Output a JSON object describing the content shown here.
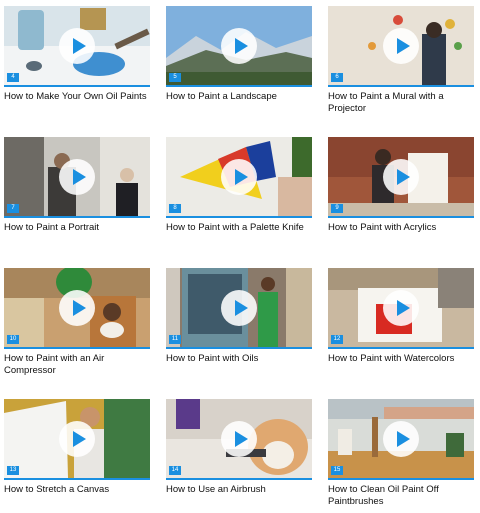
{
  "accent_color": "#1a8fe0",
  "videos": [
    {
      "number": "4",
      "title": "How to Make Your Own Oil Paints",
      "play_icon": "play-icon"
    },
    {
      "number": "5",
      "title": "How to Paint a Landscape",
      "play_icon": "play-icon"
    },
    {
      "number": "6",
      "title": "How to Paint a Mural with a Projector",
      "play_icon": "play-icon"
    },
    {
      "number": "7",
      "title": "How to Paint a Portrait",
      "play_icon": "play-icon"
    },
    {
      "number": "8",
      "title": "How to Paint with a Palette Knife",
      "play_icon": "play-icon"
    },
    {
      "number": "9",
      "title": "How to Paint with Acrylics",
      "play_icon": "play-icon"
    },
    {
      "number": "10",
      "title": "How to Paint with an Air Compressor",
      "play_icon": "play-icon"
    },
    {
      "number": "11",
      "title": "How to Paint with Oils",
      "play_icon": "play-icon"
    },
    {
      "number": "12",
      "title": "How to Paint with Watercolors",
      "play_icon": "play-icon"
    },
    {
      "number": "13",
      "title": "How to Stretch a Canvas",
      "play_icon": "play-icon"
    },
    {
      "number": "14",
      "title": "How to Use an Airbrush",
      "play_icon": "play-icon"
    },
    {
      "number": "15",
      "title": "How to Clean Oil Paint Off Paintbrushes",
      "play_icon": "play-icon"
    }
  ]
}
